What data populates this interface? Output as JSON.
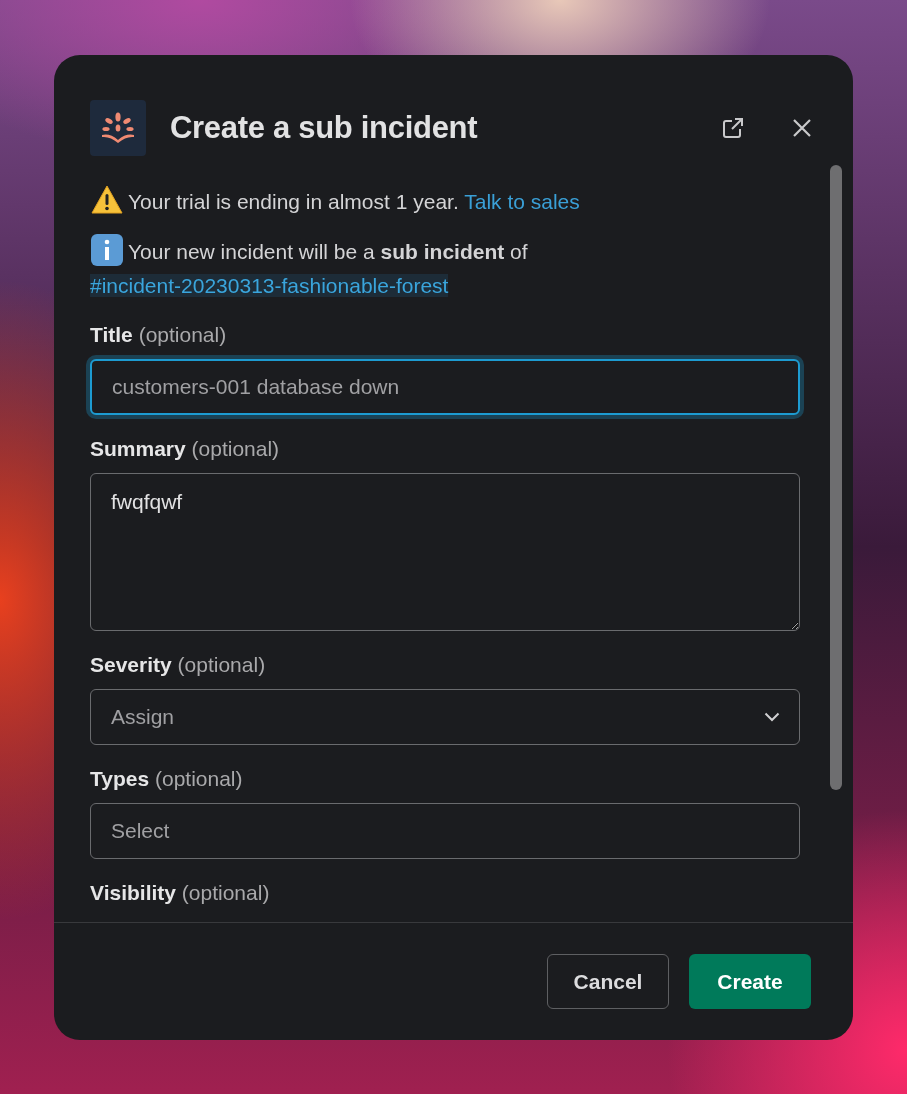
{
  "dialog": {
    "title": "Create a sub incident"
  },
  "notices": [
    {
      "kind": "warning",
      "text": "Your trial is ending in almost 1 year.",
      "link": "Talk to sales"
    },
    {
      "kind": "info",
      "text": "Your new incident will be a **sub incident** of",
      "link": "#incident-20230313-fashionable-forest"
    }
  ],
  "fields": [
    {
      "kind": "input",
      "label": "Title",
      "hint": "(optional)",
      "placeholder": "customers-001 database down",
      "focused": true
    },
    {
      "kind": "textarea",
      "label": "Summary",
      "hint": "(optional)",
      "value": "fwqfqwf",
      "focused": false
    },
    {
      "kind": "select",
      "label": "Severity",
      "hint": "(optional)",
      "placeholder": "Assign",
      "focused": false
    },
    {
      "kind": "input",
      "label": "Types",
      "hint": "(optional)",
      "placeholder": "Select",
      "focused": false
    },
    {
      "kind": "label",
      "label": "Visibility",
      "hint": "(optional)"
    }
  ],
  "buttons": [
    {
      "kind": "secondary",
      "label": "Cancel"
    },
    {
      "kind": "primary",
      "label": "Create"
    }
  ]
}
